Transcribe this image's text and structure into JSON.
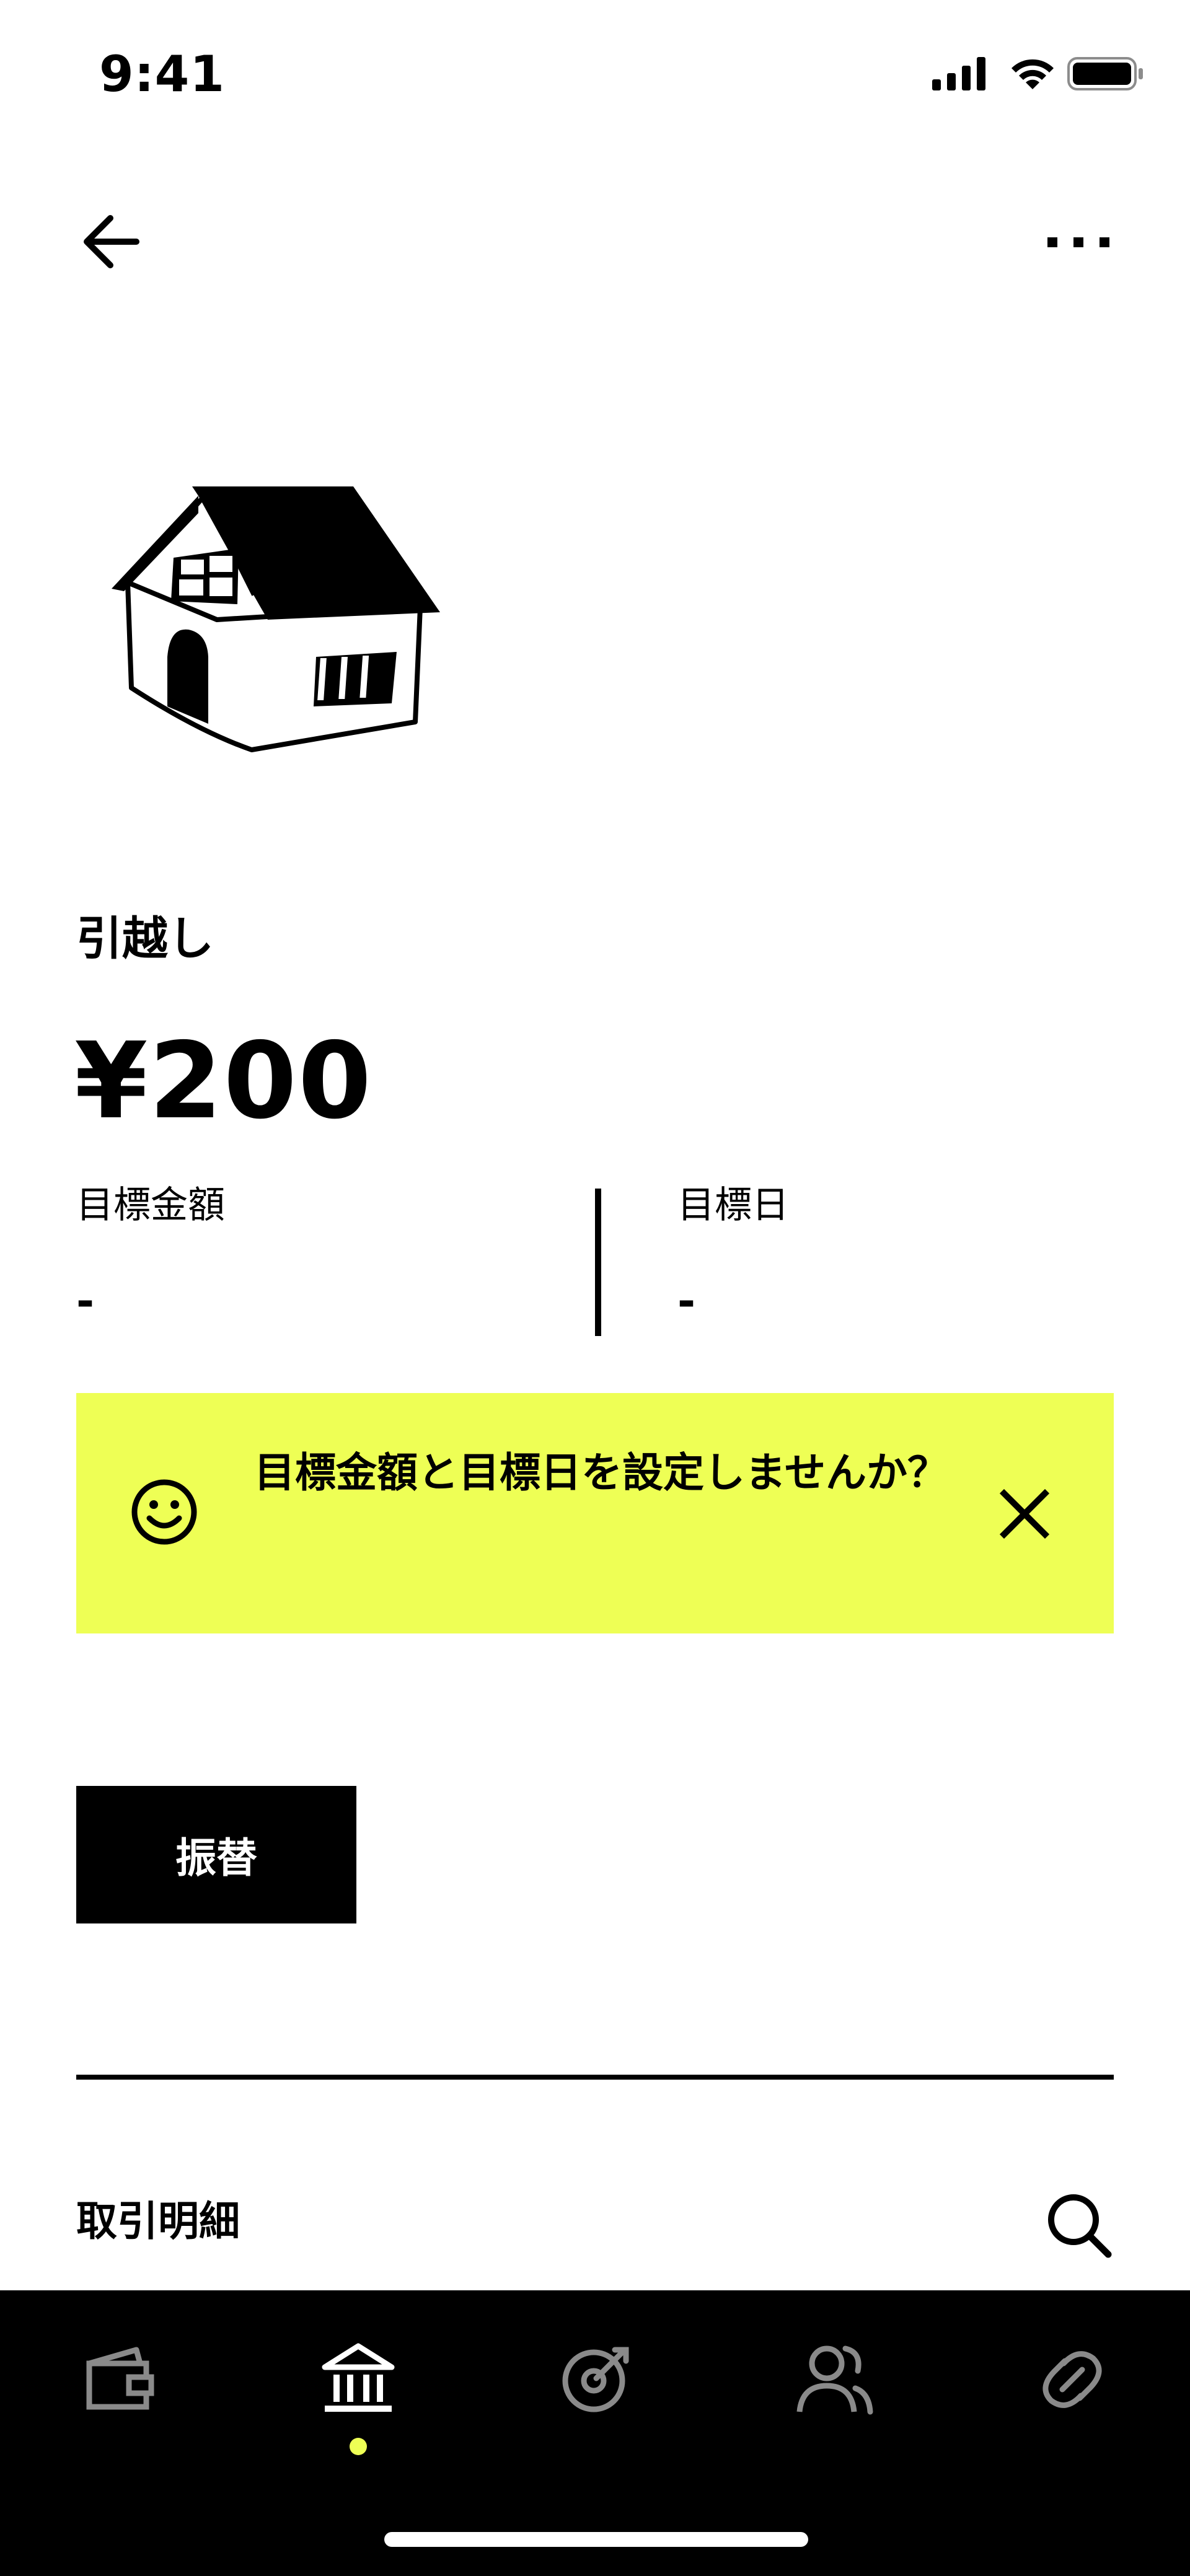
{
  "status_bar": {
    "time": "9:41"
  },
  "nav": {
    "back_icon": "arrow-left-icon",
    "more_icon": "ellipsis-icon"
  },
  "goal": {
    "illustration": "house-illustration",
    "name": "引越し",
    "balance": "¥200",
    "target_amount": {
      "label": "目標金額",
      "value": "-"
    },
    "target_date": {
      "label": "目標日",
      "value": "-"
    }
  },
  "banner": {
    "icon": "smiley-icon",
    "text": "目標金額と目標日を設定しませんか？",
    "close_icon": "close-icon",
    "background": "#EEFF55"
  },
  "actions": {
    "transfer_label": "振替"
  },
  "transactions": {
    "title": "取引明細",
    "search_icon": "search-icon"
  },
  "tabbar": {
    "active_index": 1,
    "tabs": [
      {
        "icon": "wallet-icon"
      },
      {
        "icon": "bank-icon"
      },
      {
        "icon": "target-icon"
      },
      {
        "icon": "people-icon"
      },
      {
        "icon": "link-icon"
      }
    ],
    "active_dot_color": "#EEFF55"
  }
}
